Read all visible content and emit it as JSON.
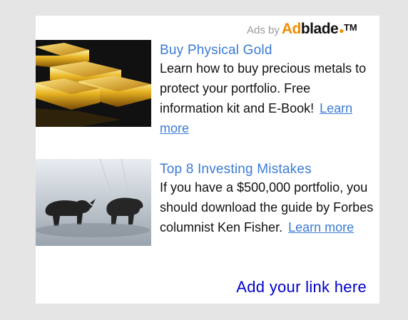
{
  "header": {
    "ads_by_label": "Ads by",
    "brand_ad": "Ad",
    "brand_rest": "blade",
    "trademark": "TM"
  },
  "ads": [
    {
      "title": "Buy Physical Gold",
      "description": "Learn how to buy precious metals to protect your portfolio. Free information kit and E-Book!",
      "cta": "Learn more",
      "image": "gold-bars-image"
    },
    {
      "title": "Top 8 Investing Mistakes",
      "description": "If you have a $500,000 portfolio, you should download the guide by Forbes columnist Ken Fisher.",
      "cta": "Learn more",
      "image": "bull-bear-image"
    }
  ],
  "footer": {
    "add_link": "Add your link here"
  },
  "colors": {
    "background": "#e5e5e5",
    "link": "#3b7bd6",
    "add_link": "#0000cc",
    "brand_orange": "#f28c00"
  }
}
